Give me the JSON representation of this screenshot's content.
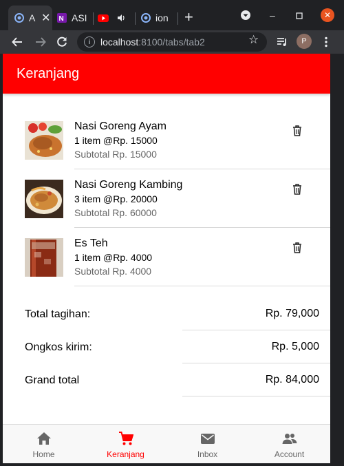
{
  "browser": {
    "tabs": [
      {
        "title": "A",
        "icon": "ionic-icon"
      },
      {
        "title": "ASI",
        "icon": "onenote-icon"
      },
      {
        "title": "",
        "icon": "youtube-icon"
      },
      {
        "title": "ion",
        "icon": "ionic-icon"
      }
    ],
    "url_host": "localhost",
    "url_path": ":8100/tabs/tab2",
    "profile_initial": "P"
  },
  "app": {
    "header_title": "Keranjang",
    "cart_items": [
      {
        "name": "Nasi Goreng Ayam",
        "qty_line": "1 item @Rp. 15000",
        "subtotal": "Subtotal Rp. 15000"
      },
      {
        "name": "Nasi Goreng Kambing",
        "qty_line": "3 item @Rp. 20000",
        "subtotal": "Subtotal Rp. 60000"
      },
      {
        "name": "Es Teh",
        "qty_line": "1 item @Rp. 4000",
        "subtotal": "Subtotal Rp. 4000"
      }
    ],
    "summary": [
      {
        "label": "Total tagihan:",
        "value": "Rp. 79,000"
      },
      {
        "label": "Ongkos kirim:",
        "value": "Rp. 5,000"
      },
      {
        "label": "Grand total",
        "value": "Rp. 84,000"
      }
    ],
    "tabs": [
      {
        "label": "Home",
        "icon": "home-icon"
      },
      {
        "label": "Keranjang",
        "icon": "cart-icon"
      },
      {
        "label": "Inbox",
        "icon": "mail-icon"
      },
      {
        "label": "Account",
        "icon": "people-icon"
      }
    ],
    "colors": {
      "accent": "#ff0000",
      "muted_text": "#666666"
    }
  }
}
